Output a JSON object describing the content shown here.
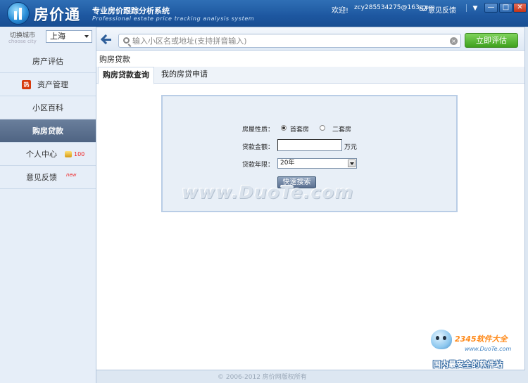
{
  "app": {
    "logo_text": "房价通",
    "slogan": "专业房价跟踪分析系统",
    "slogan_en": "Professional estate price tracking analysis system"
  },
  "titlebar": {
    "welcome": "欢迎!",
    "user_email": "zcy285534275@163.com",
    "feedback": "意见反馈",
    "menu": "▼",
    "minimize": "—",
    "maximize": "□",
    "close": "✕"
  },
  "sidebar": {
    "city_label": "切换城市",
    "city_label_en": "choose city",
    "city_value": "上海",
    "items": [
      {
        "label": "房产评估"
      },
      {
        "label": "资产管理",
        "badge": "热"
      },
      {
        "label": "小区百科"
      },
      {
        "label": "购房贷款"
      },
      {
        "label": "个人中心",
        "points": "100"
      },
      {
        "label": "意见反馈",
        "tag": "new"
      }
    ]
  },
  "toolbar": {
    "search_placeholder": "输入小区名或地址(支持拼音输入)",
    "clear": "×",
    "evaluate_label": "立即评估"
  },
  "main": {
    "section_title": "购房贷款",
    "tabs": [
      {
        "label": "购房贷款查询"
      },
      {
        "label": "我的房贷申请"
      }
    ],
    "form": {
      "property_type_label": "房屋性质：",
      "first_home_label": "首套房",
      "second_home_label": "二套房",
      "amount_label": "贷款金额：",
      "amount_value": "",
      "amount_unit": "万元",
      "years_label": "贷款年限：",
      "years_value": "20年",
      "search_button": "快速搜索"
    }
  },
  "watermark": "www.DuoTe.com",
  "footer": "© 2006-2012  房价网版权所有",
  "corner_brand": {
    "name": "2345软件大全",
    "url": "www.DuoTe.com",
    "slogan": "国内最安全的软件站"
  }
}
